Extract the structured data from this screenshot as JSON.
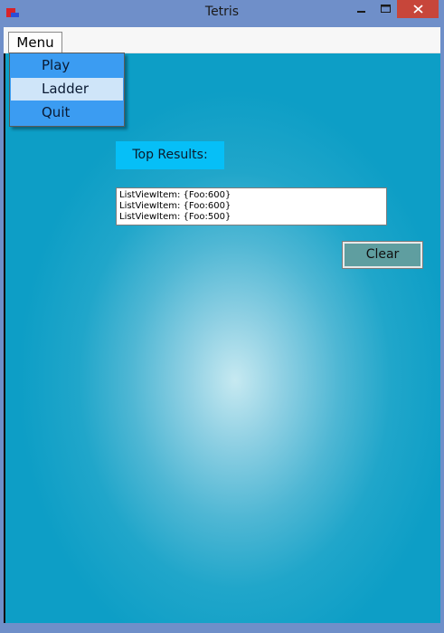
{
  "window": {
    "title": "Tetris"
  },
  "menustrip": {
    "menu_label": "Menu"
  },
  "dropdown": {
    "items": [
      {
        "label": "Play",
        "highlighted": false
      },
      {
        "label": "Ladder",
        "highlighted": true
      },
      {
        "label": "Quit",
        "highlighted": false
      }
    ]
  },
  "results": {
    "label": "Top Results:",
    "items": [
      "ListViewItem: {Foo:600}",
      "ListViewItem: {Foo:600}",
      "ListViewItem: {Foo:500}"
    ],
    "clear_label": "Clear"
  },
  "icons": {
    "app": "tetris-icon",
    "minimize": "minimize-icon",
    "maximize": "maximize-icon",
    "close": "close-icon"
  },
  "colors": {
    "titlebar": "#6f8fc9",
    "close_button": "#c7463a",
    "dropdown_bg": "#3b9cf2",
    "dropdown_hover": "#cfe5f9",
    "label_bg": "#06bff7",
    "clear_button": "#5f9ea0",
    "client_center": "#c6e9f1",
    "client_edge": "#0d9ec6"
  }
}
